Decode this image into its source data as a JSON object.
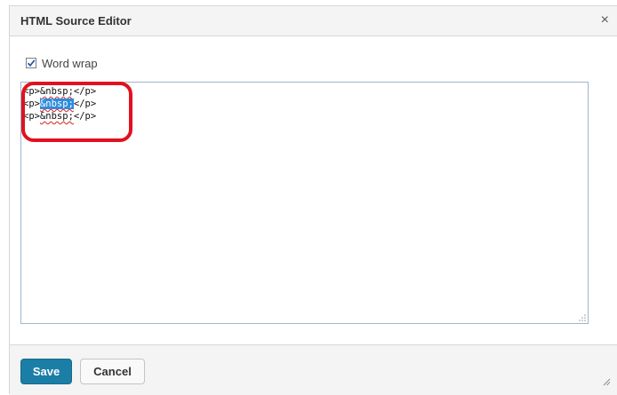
{
  "dialog": {
    "title": "HTML Source Editor",
    "close_label": "×"
  },
  "options": {
    "word_wrap_label": "Word wrap",
    "word_wrap_checked": true
  },
  "editor": {
    "line1": {
      "open": "<p>",
      "entity": "&nbsp;",
      "close": "</p>"
    },
    "line2": {
      "open": "<p>",
      "entity": "&nbsp;",
      "close": "</p>"
    },
    "line3": {
      "open": "<p>",
      "entity": "&nbsp;",
      "close": "</p>"
    },
    "selected_text": "&nbsp;"
  },
  "footer": {
    "save_label": "Save",
    "cancel_label": "Cancel"
  },
  "colors": {
    "primary_button": "#1b7ea6",
    "selection": "#2f8cdc",
    "annotation": "#e1111e"
  }
}
